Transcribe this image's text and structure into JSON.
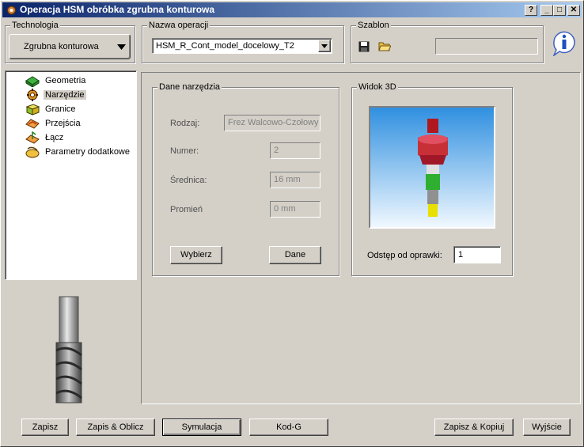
{
  "window": {
    "title": "Operacja HSM obróbka zgrubna konturowa",
    "buttons": {
      "help": "?",
      "minimize": "_",
      "maximize": "□",
      "close": "✕"
    }
  },
  "technologia": {
    "label": "Technologia",
    "value": "Zgrubna konturowa"
  },
  "nazwa_operacji": {
    "label": "Nazwa operacji",
    "value": "HSM_R_Cont_model_docelowy_T2"
  },
  "szablon": {
    "label": "Szablon",
    "value": ""
  },
  "tree": {
    "items": [
      {
        "label": "Geometria",
        "icon": "geometry-icon"
      },
      {
        "label": "Narzędzie",
        "icon": "tool-gear-icon"
      },
      {
        "label": "Granice",
        "icon": "boundary-box-icon"
      },
      {
        "label": "Przejścia",
        "icon": "passes-icon"
      },
      {
        "label": "Łącz",
        "icon": "link-icon"
      },
      {
        "label": "Parametry dodatkowe",
        "icon": "extra-params-icon"
      }
    ],
    "selected_index": 1
  },
  "dane_narzedzia": {
    "label": "Dane narzędzia",
    "rodzaj_label": "Rodzaj:",
    "rodzaj_value": "Frez Walcowo-Czołowy",
    "numer_label": "Numer:",
    "numer_value": "2",
    "srednica_label": "Średnica:",
    "srednica_value": "16 mm",
    "promien_label": "Promień",
    "promien_value": "0 mm",
    "wybierz_button": "Wybierz",
    "dane_button": "Dane"
  },
  "widok_3d": {
    "label": "Widok 3D",
    "odstep_label": "Odstęp od oprawki:",
    "odstep_value": "1"
  },
  "footer": {
    "zapisz": "Zapisz",
    "zapis_oblicz": "Zapis & Oblicz",
    "symulacja": "Symulacja",
    "kod_g": "Kod-G",
    "zapisz_kopiuj": "Zapisz & Kopiuj",
    "wyjscie": "Wyjście"
  },
  "colors": {
    "face": "#d4d0c8",
    "title_start": "#0a246a",
    "title_end": "#a6caf0",
    "holder_red": "#c0202a",
    "tool_green": "#2fae2f",
    "tip_yellow": "#e8e000"
  }
}
